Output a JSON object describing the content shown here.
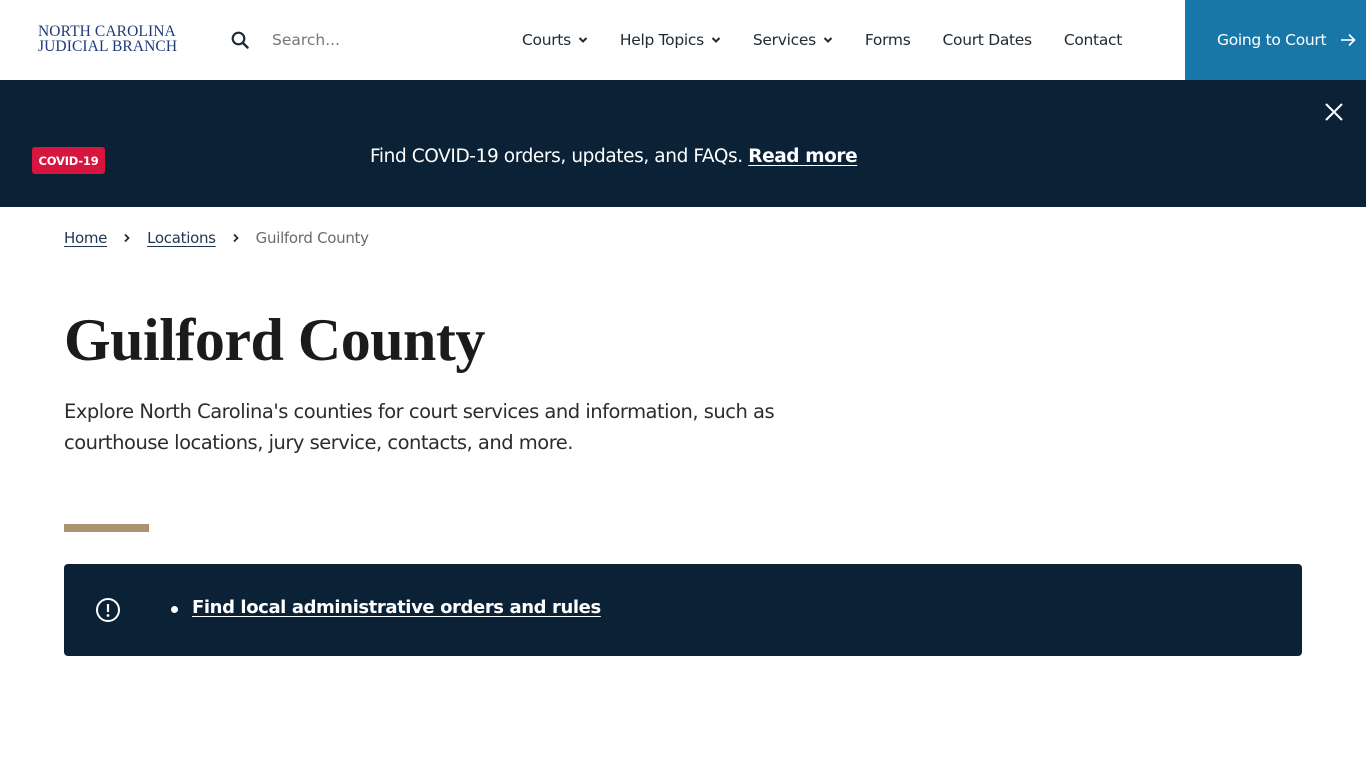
{
  "header": {
    "logo": {
      "line1": "NORTH CAROLINA",
      "line2": "JUDICIAL BRANCH",
      "color": "#1f3a7a"
    },
    "search": {
      "icon": "search-icon",
      "placeholder": "Search...",
      "value": ""
    },
    "nav": [
      {
        "label": "Courts",
        "has_dropdown": true
      },
      {
        "label": "Help Topics",
        "has_dropdown": true
      },
      {
        "label": "Services",
        "has_dropdown": true
      },
      {
        "label": "Forms",
        "has_dropdown": false
      },
      {
        "label": "Court Dates",
        "has_dropdown": false
      },
      {
        "label": "Contact",
        "has_dropdown": false
      }
    ],
    "cta": {
      "label": "Going to Court",
      "icon": "arrow-right-icon",
      "color": "#1976a9"
    }
  },
  "banner": {
    "badge": "COVID-19",
    "badge_color": "#d6163f",
    "text": "Find COVID-19 orders, updates, and FAQs.",
    "link_label": "Read more",
    "close_icon": "close-icon",
    "background": "#0a2136"
  },
  "breadcrumb": {
    "items": [
      {
        "label": "Home",
        "link": true
      },
      {
        "label": "Locations",
        "link": true
      },
      {
        "label": "Guilford County",
        "link": false
      }
    ]
  },
  "page": {
    "title": "Guilford County",
    "description": "Explore North Carolina's counties for court services and information, such as courthouse locations, jury service, contacts, and more.",
    "accent_color": "#ad9471"
  },
  "alert": {
    "icon": "exclamation-circle-icon",
    "items": [
      {
        "label": "Find local administrative orders and rules"
      }
    ]
  }
}
